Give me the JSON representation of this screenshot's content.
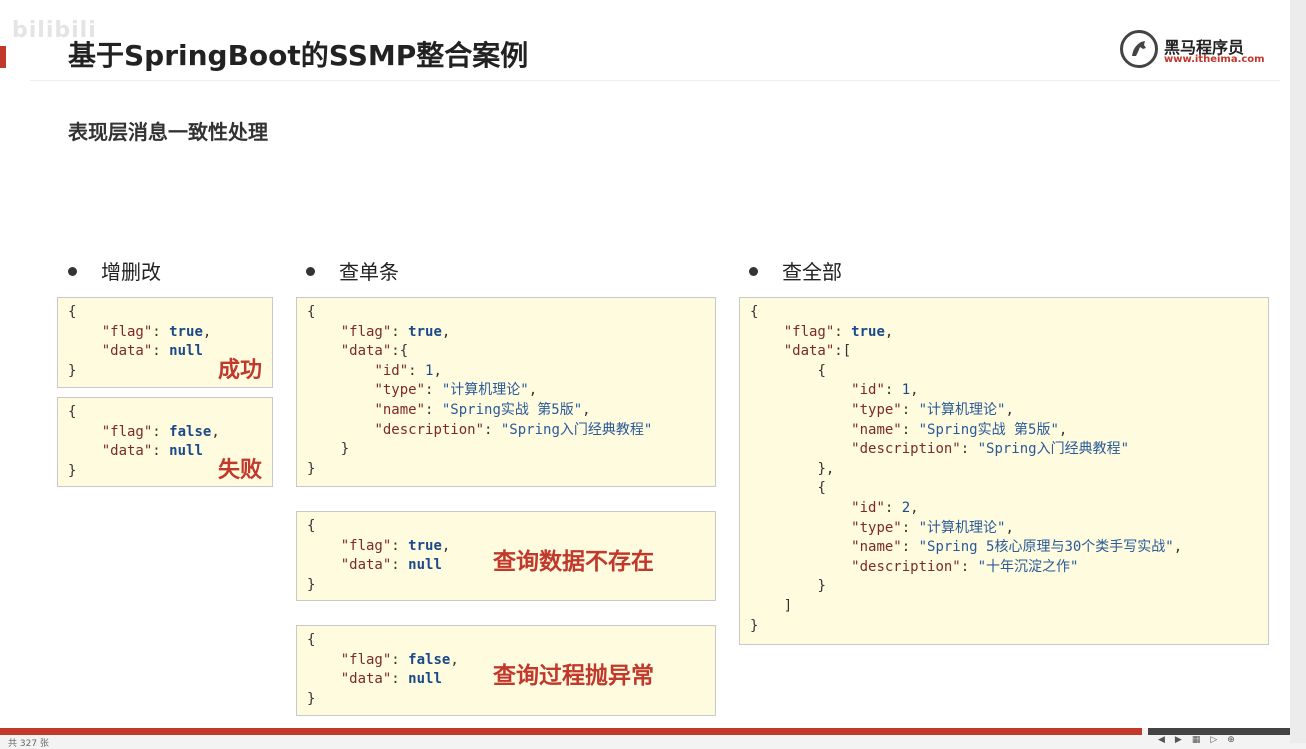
{
  "watermark": "bilibili",
  "title": "基于SpringBoot的SSMP整合案例",
  "logo": {
    "name": "黑马程序员",
    "url": "www.itheima.com"
  },
  "section": "表现层消息一致性处理",
  "bullets": {
    "cud": "增删改",
    "single": "查单条",
    "all": "查全部"
  },
  "tags": {
    "success": "成功",
    "fail": "失败",
    "not_found": "查询数据不存在",
    "exception": "查询过程抛异常"
  },
  "json": {
    "k_flag": "\"flag\"",
    "k_data": "\"data\"",
    "k_id": "\"id\"",
    "k_type": "\"type\"",
    "k_name": "\"name\"",
    "k_description": "\"description\"",
    "v_true": "true",
    "v_false": "false",
    "v_null": "null",
    "v_id1": "1",
    "v_id2": "2",
    "v_type": "\"计算机理论\"",
    "v_name1": "\"Spring实战 第5版\"",
    "v_desc1": "\"Spring入门经典教程\"",
    "v_name2": "\"Spring 5核心原理与30个类手写实战\"",
    "v_desc2": "\"十年沉淀之作\""
  },
  "footer": {
    "page": "共 327 张"
  },
  "colors": {
    "accent": "#c0392b",
    "code_bg": "#fffbdf"
  },
  "icons": [
    "previous-icon",
    "play-icon",
    "grid-icon",
    "next-icon",
    "zoom-icon"
  ]
}
